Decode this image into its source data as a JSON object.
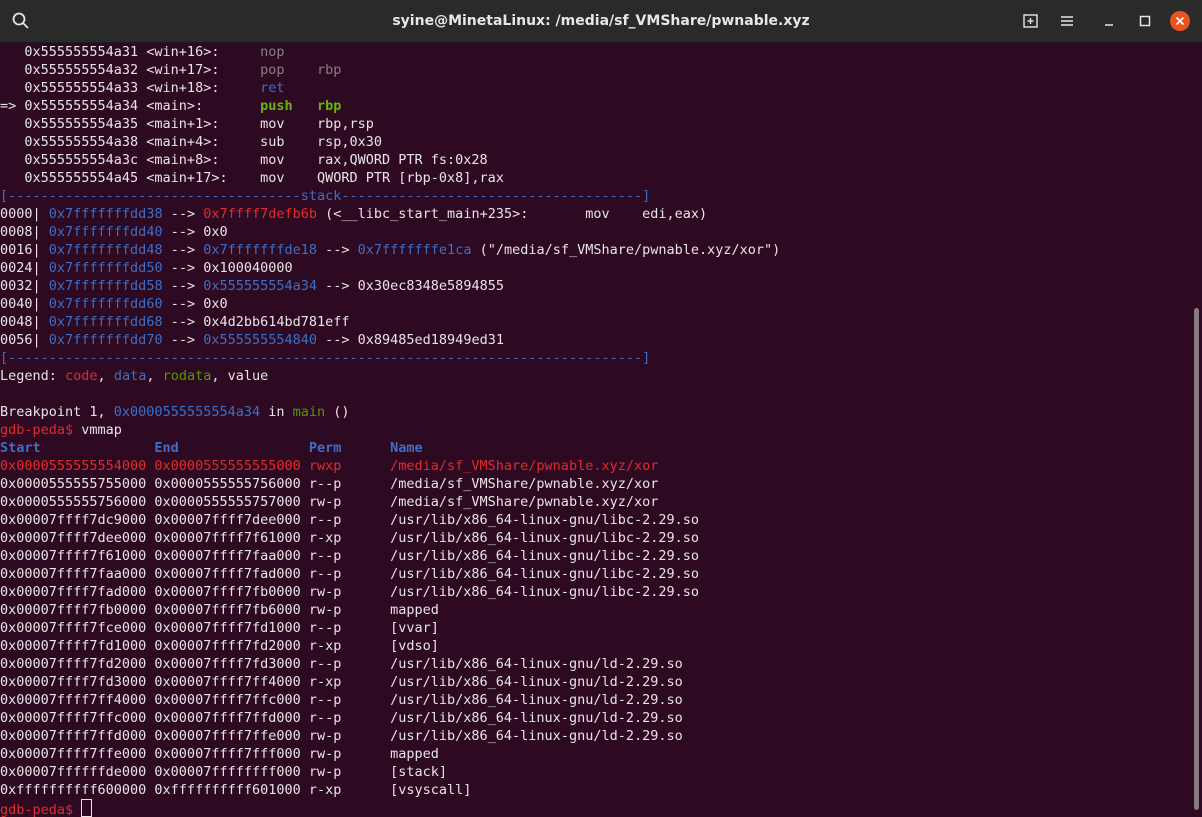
{
  "window": {
    "title": "syine@MinetaLinux: /media/sf_VMShare/pwnable.xyz",
    "icons": [
      "search-icon",
      "new-tab-icon",
      "menu-icon",
      "minimize-icon",
      "maximize-icon",
      "close-icon"
    ]
  },
  "colors": {
    "background": "#2d0922",
    "text": "#e9e4e6",
    "code": "#e02c2c",
    "data": "#3d6fc7",
    "rodata": "#4e9a06",
    "dim": "#8a7f86",
    "highlight": "#6ab40c",
    "close": "#e95420"
  },
  "terminal": {
    "lines": [
      [
        {
          "t": "   0x555555554a31 <win+16>:     "
        },
        {
          "t": "nop",
          "c": "dim"
        }
      ],
      [
        {
          "t": "   0x555555554a32 <win+17>:     "
        },
        {
          "t": "pop    rbp",
          "c": "dim"
        }
      ],
      [
        {
          "t": "   0x555555554a33 <win+18>:     "
        },
        {
          "t": "ret",
          "c": "data"
        }
      ],
      [
        {
          "t": "=> 0x555555554a34 <main>:       "
        },
        {
          "t": "push   rbp",
          "c": "highlight",
          "b": true
        }
      ],
      [
        {
          "t": "   0x555555554a35 <main+1>:     mov    rbp,rsp"
        }
      ],
      [
        {
          "t": "   0x555555554a38 <main+4>:     sub    rsp,0x30"
        }
      ],
      [
        {
          "t": "   0x555555554a3c <main+8>:     mov    rax,QWORD PTR fs:0x28"
        }
      ],
      [
        {
          "t": "   0x555555554a45 <main+17>:    mov    QWORD PTR [rbp-0x8],rax"
        }
      ],
      [
        {
          "t": "[------------------------------------stack-------------------------------------]",
          "c": "data"
        }
      ],
      [
        {
          "t": "0000| "
        },
        {
          "t": "0x7fffffffdd38",
          "c": "data"
        },
        {
          "t": " --> "
        },
        {
          "t": "0x7ffff7defb6b",
          "c": "code"
        },
        {
          "t": " (<__libc_start_main+235>:       mov    edi,eax)"
        }
      ],
      [
        {
          "t": "0008| "
        },
        {
          "t": "0x7fffffffdd40",
          "c": "data"
        },
        {
          "t": " --> 0x0"
        }
      ],
      [
        {
          "t": "0016| "
        },
        {
          "t": "0x7fffffffdd48",
          "c": "data"
        },
        {
          "t": " --> "
        },
        {
          "t": "0x7fffffffde18",
          "c": "data"
        },
        {
          "t": " --> "
        },
        {
          "t": "0x7fffffffe1ca",
          "c": "data"
        },
        {
          "t": " (\"/media/sf_VMShare/pwnable.xyz/xor\")"
        }
      ],
      [
        {
          "t": "0024| "
        },
        {
          "t": "0x7fffffffdd50",
          "c": "data"
        },
        {
          "t": " --> 0x100040000"
        }
      ],
      [
        {
          "t": "0032| "
        },
        {
          "t": "0x7fffffffdd58",
          "c": "data"
        },
        {
          "t": " --> "
        },
        {
          "t": "0x555555554a34",
          "c": "data"
        },
        {
          "t": " --> 0x30ec8348e5894855"
        }
      ],
      [
        {
          "t": "0040| "
        },
        {
          "t": "0x7fffffffdd60",
          "c": "data"
        },
        {
          "t": " --> 0x0"
        }
      ],
      [
        {
          "t": "0048| "
        },
        {
          "t": "0x7fffffffdd68",
          "c": "data"
        },
        {
          "t": " --> 0x4d2bb614bd781eff"
        }
      ],
      [
        {
          "t": "0056| "
        },
        {
          "t": "0x7fffffffdd70",
          "c": "data"
        },
        {
          "t": " --> "
        },
        {
          "t": "0x555555554840",
          "c": "data"
        },
        {
          "t": " --> 0x89485ed18949ed31"
        }
      ],
      [
        {
          "t": "[------------------------------------------------------------------------------]",
          "c": "data"
        }
      ],
      [
        {
          "t": "Legend: "
        },
        {
          "t": "code",
          "c": "code"
        },
        {
          "t": ", "
        },
        {
          "t": "data",
          "c": "data"
        },
        {
          "t": ", "
        },
        {
          "t": "rodata",
          "c": "rodata"
        },
        {
          "t": ", value"
        }
      ],
      [
        {
          "t": ""
        }
      ],
      [
        {
          "t": "Breakpoint 1, "
        },
        {
          "t": "0x0000555555554a34",
          "c": "data"
        },
        {
          "t": " in "
        },
        {
          "t": "main",
          "c": "rodata"
        },
        {
          "t": " ()"
        }
      ],
      [
        {
          "t": "gdb-peda$ ",
          "c": "code"
        },
        {
          "t": "vmmap"
        }
      ],
      [
        {
          "t": "Start              End                Perm      Name",
          "c": "data",
          "b": true
        }
      ],
      [
        {
          "t": "0x0000555555554000 0x0000555555555000 rwxp      /media/sf_VMShare/pwnable.xyz/xor",
          "c": "code"
        }
      ],
      [
        {
          "t": "0x0000555555755000 0x0000555555756000 r--p      /media/sf_VMShare/pwnable.xyz/xor"
        }
      ],
      [
        {
          "t": "0x0000555555756000 0x0000555555757000 rw-p      /media/sf_VMShare/pwnable.xyz/xor"
        }
      ],
      [
        {
          "t": "0x00007ffff7dc9000 0x00007ffff7dee000 r--p      /usr/lib/x86_64-linux-gnu/libc-2.29.so"
        }
      ],
      [
        {
          "t": "0x00007ffff7dee000 0x00007ffff7f61000 r-xp      /usr/lib/x86_64-linux-gnu/libc-2.29.so"
        }
      ],
      [
        {
          "t": "0x00007ffff7f61000 0x00007ffff7faa000 r--p      /usr/lib/x86_64-linux-gnu/libc-2.29.so"
        }
      ],
      [
        {
          "t": "0x00007ffff7faa000 0x00007ffff7fad000 r--p      /usr/lib/x86_64-linux-gnu/libc-2.29.so"
        }
      ],
      [
        {
          "t": "0x00007ffff7fad000 0x00007ffff7fb0000 rw-p      /usr/lib/x86_64-linux-gnu/libc-2.29.so"
        }
      ],
      [
        {
          "t": "0x00007ffff7fb0000 0x00007ffff7fb6000 rw-p      mapped"
        }
      ],
      [
        {
          "t": "0x00007ffff7fce000 0x00007ffff7fd1000 r--p      [vvar]"
        }
      ],
      [
        {
          "t": "0x00007ffff7fd1000 0x00007ffff7fd2000 r-xp      [vdso]"
        }
      ],
      [
        {
          "t": "0x00007ffff7fd2000 0x00007ffff7fd3000 r--p      /usr/lib/x86_64-linux-gnu/ld-2.29.so"
        }
      ],
      [
        {
          "t": "0x00007ffff7fd3000 0x00007ffff7ff4000 r-xp      /usr/lib/x86_64-linux-gnu/ld-2.29.so"
        }
      ],
      [
        {
          "t": "0x00007ffff7ff4000 0x00007ffff7ffc000 r--p      /usr/lib/x86_64-linux-gnu/ld-2.29.so"
        }
      ],
      [
        {
          "t": "0x00007ffff7ffc000 0x00007ffff7ffd000 r--p      /usr/lib/x86_64-linux-gnu/ld-2.29.so"
        }
      ],
      [
        {
          "t": "0x00007ffff7ffd000 0x00007ffff7ffe000 rw-p      /usr/lib/x86_64-linux-gnu/ld-2.29.so"
        }
      ],
      [
        {
          "t": "0x00007ffff7ffe000 0x00007ffff7fff000 rw-p      mapped"
        }
      ],
      [
        {
          "t": "0x00007ffffffde000 0x00007ffffffff000 rw-p      [stack]"
        }
      ],
      [
        {
          "t": "0xffffffffff600000 0xffffffffff601000 r-xp      [vsyscall]"
        }
      ],
      [
        {
          "t": "gdb-peda$ ",
          "c": "code"
        },
        {
          "cursor": true
        }
      ]
    ]
  }
}
